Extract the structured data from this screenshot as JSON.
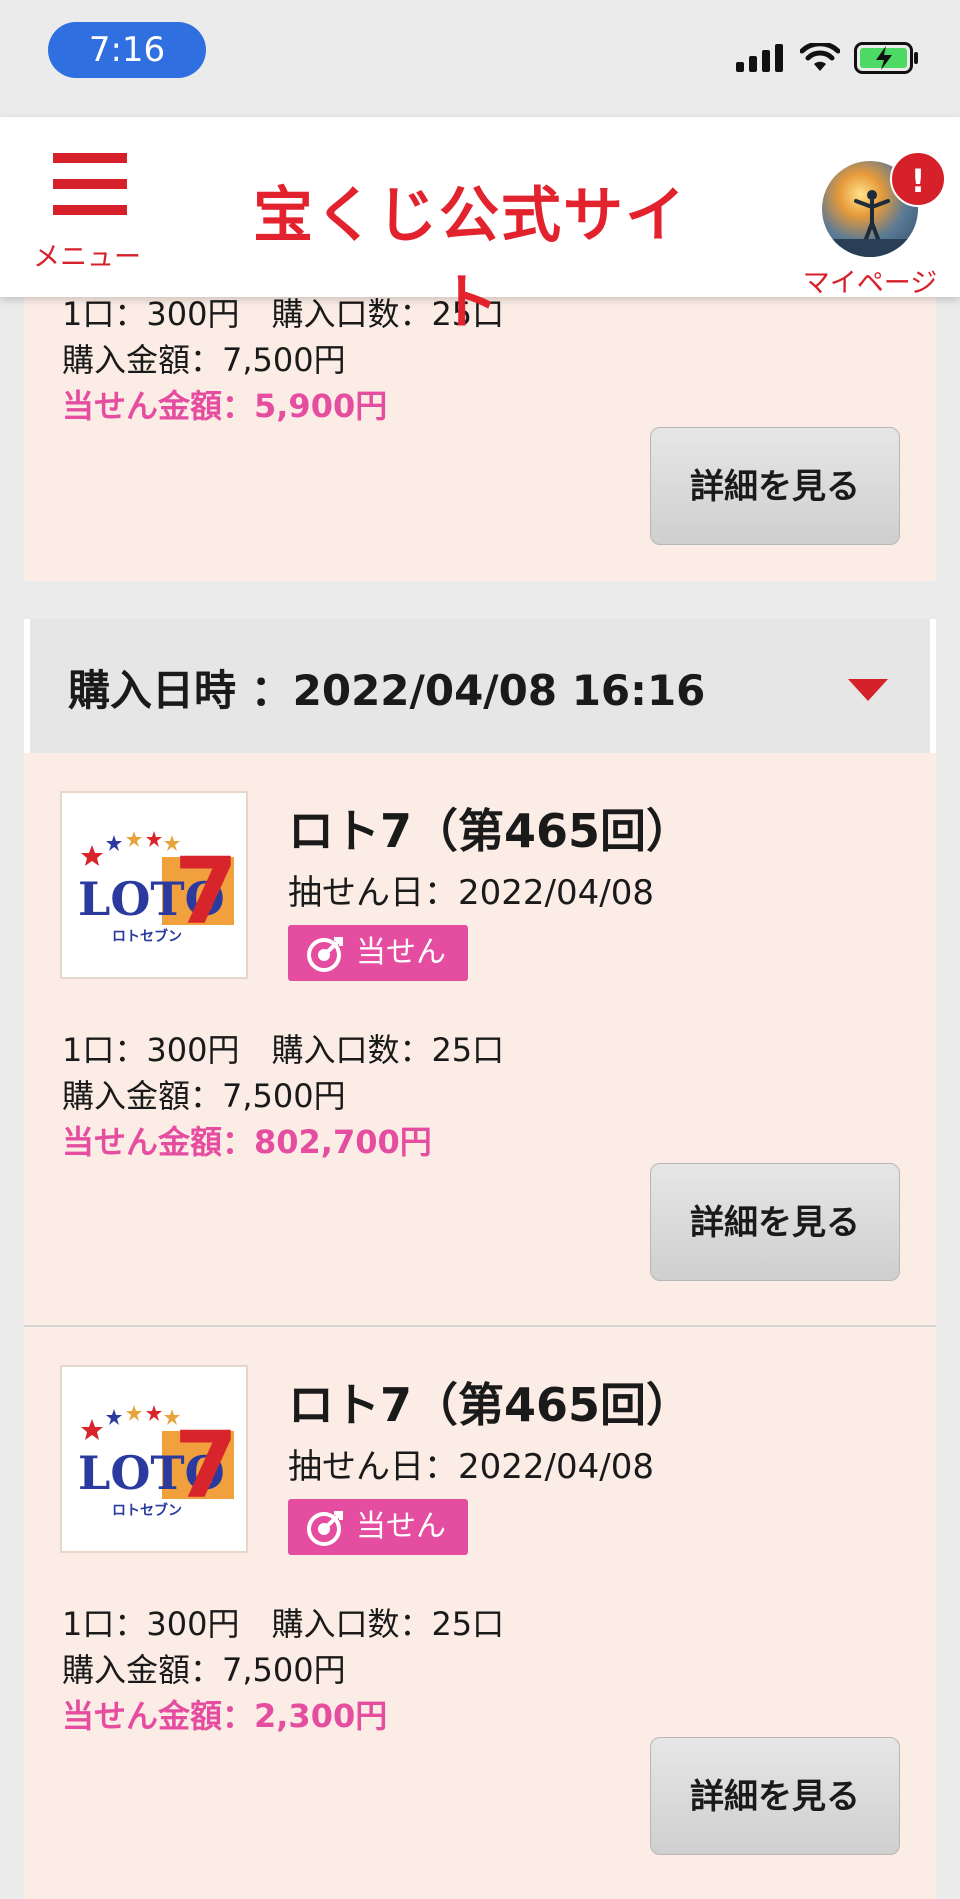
{
  "status_bar": {
    "time": "7:16"
  },
  "header": {
    "menu_label": "メニュー",
    "site_title": "宝くじ公式サイト",
    "mypage_label": "マイページ",
    "alert_badge": "!"
  },
  "colors": {
    "accent_red": "#d6202a",
    "prize_pink": "#e54da0",
    "card_bg": "#fbede5"
  },
  "top_card": {
    "line1": "1口：300円　購入口数：25口",
    "line2": "購入金額：7,500円",
    "prize": "当せん金額：5,900円",
    "button": "詳細を見る"
  },
  "purchase_group": {
    "date_label": "購入日時 ：2022/04/08 16:16",
    "tickets": [
      {
        "game": "ロト7（第465回）",
        "draw_date": "抽せん日：2022/04/08",
        "status": "当せん",
        "line1": "1口：300円　購入口数：25口",
        "line2": "購入金額：7,500円",
        "prize": "当せん金額：802,700円",
        "button": "詳細を見る",
        "logo": {
          "word": "LOTO",
          "number": "7",
          "kana": "ロトセブン"
        }
      },
      {
        "game": "ロト7（第465回）",
        "draw_date": "抽せん日：2022/04/08",
        "status": "当せん",
        "line1": "1口：300円　購入口数：25口",
        "line2": "購入金額：7,500円",
        "prize": "当せん金額：2,300円",
        "button": "詳細を見る",
        "logo": {
          "word": "LOTO",
          "number": "7",
          "kana": "ロトセブン"
        }
      }
    ]
  }
}
